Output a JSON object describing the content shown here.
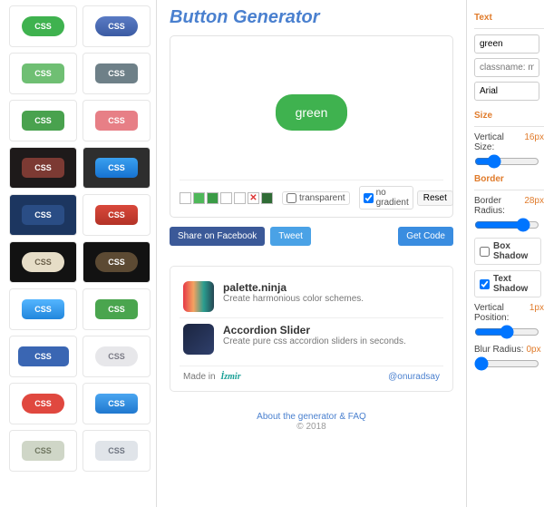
{
  "presets": {
    "label": "CSS"
  },
  "main": {
    "title": "Button Generator",
    "preview_label": "green",
    "swatches": [
      "#ffffff",
      "#4fb85a",
      "#3a9b46",
      "#ffffff",
      "#ffffff",
      "X",
      "#2f6b35"
    ],
    "transparent_label": "transparent",
    "transparent_checked": false,
    "nogradient_label": "no gradient",
    "nogradient_checked": true,
    "reset_label": "Reset",
    "share_fb": "Share on Facebook",
    "tweet": "Tweet",
    "get_code": "Get Code",
    "promos": [
      {
        "title": "palette.ninja",
        "sub": "Create harmonious color schemes."
      },
      {
        "title": "Accordion Slider",
        "sub": "Create pure css accordion sliders in seconds."
      }
    ],
    "madein_prefix": "Made in",
    "madein_brand": "İzmir",
    "handle": "@onuradsay",
    "footer_link": "About the generator & FAQ",
    "footer_copy": "© 2018"
  },
  "controls": {
    "text": {
      "title": "Text",
      "text_value": "green",
      "class_placeholder": "classname: myBut",
      "font_value": "Arial"
    },
    "size": {
      "title": "Size",
      "vsize_label": "Vertical Size:",
      "vsize_value": "16px",
      "vsize_slider": 25
    },
    "border": {
      "title": "Border",
      "radius_label": "Border Radius:",
      "radius_value": "28px",
      "radius_slider": 82
    },
    "boxshadow": {
      "label": "Box Shadow",
      "checked": false
    },
    "textshadow": {
      "label": "Text Shadow",
      "checked": true,
      "vpos_label": "Vertical Position:",
      "vpos_value": "1px",
      "vpos_slider": 50,
      "blur_label": "Blur Radius:",
      "blur_value": "0px",
      "blur_slider": 0
    }
  }
}
